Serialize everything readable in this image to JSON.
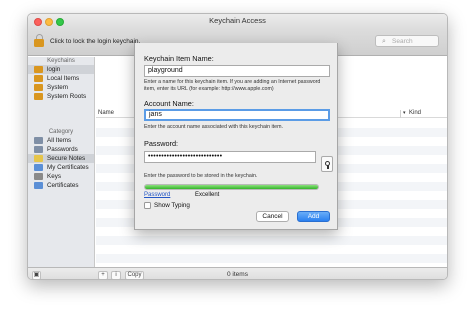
{
  "window": {
    "title": "Keychain Access"
  },
  "toolbar": {
    "lock_text": "Click to lock the login keychain.",
    "search_placeholder": "Search"
  },
  "sidebar": {
    "keychains_header": "Keychains",
    "keychains": [
      {
        "label": "login",
        "selected": true,
        "icon": "keychain-icon",
        "color": "#d9961f"
      },
      {
        "label": "Local Items",
        "selected": false,
        "icon": "keychain-icon",
        "color": "#d9961f"
      },
      {
        "label": "System",
        "selected": false,
        "icon": "keychain-icon",
        "color": "#d9961f"
      },
      {
        "label": "System Roots",
        "selected": false,
        "icon": "keychain-icon",
        "color": "#d9961f"
      }
    ],
    "category_header": "Category",
    "categories": [
      {
        "label": "All Items",
        "selected": false,
        "icon": "all-items-icon",
        "color": "#7f8fa6"
      },
      {
        "label": "Passwords",
        "selected": false,
        "icon": "passwords-icon",
        "color": "#7f8fa6"
      },
      {
        "label": "Secure Notes",
        "selected": true,
        "icon": "secure-notes-icon",
        "color": "#e6c54a"
      },
      {
        "label": "My Certificates",
        "selected": false,
        "icon": "certificate-icon",
        "color": "#5b8fd6"
      },
      {
        "label": "Keys",
        "selected": false,
        "icon": "keys-icon",
        "color": "#8a8a8a"
      },
      {
        "label": "Certificates",
        "selected": false,
        "icon": "certificate-icon",
        "color": "#5b8fd6"
      }
    ]
  },
  "list": {
    "col_name": "Name",
    "col_kind": "Kind"
  },
  "statusbar": {
    "add_label": "+",
    "info_label": "i",
    "copy_label": "Copy",
    "count_text": "0 items"
  },
  "sheet": {
    "item_name_label": "Keychain Item Name:",
    "item_name_value": "playground",
    "item_name_hint": "Enter a name for this keychain item. If you are adding an Internet password item, enter its URL (for example: http://www.apple.com)",
    "account_label": "Account Name:",
    "account_value": "jans",
    "account_hint": "Enter the account name associated with this keychain item.",
    "password_label": "Password:",
    "password_value": "••••••••••••••••••••••••••••",
    "password_hint": "Enter the password to be stored in the keychain.",
    "strength_link": "Password",
    "strength_text": "Excellent",
    "strength_fraction": 1.0,
    "show_typing_label": "Show Typing",
    "cancel_label": "Cancel",
    "add_label": "Add"
  },
  "colors": {
    "accent": "#2a80f0",
    "strength": "#34b42a"
  }
}
